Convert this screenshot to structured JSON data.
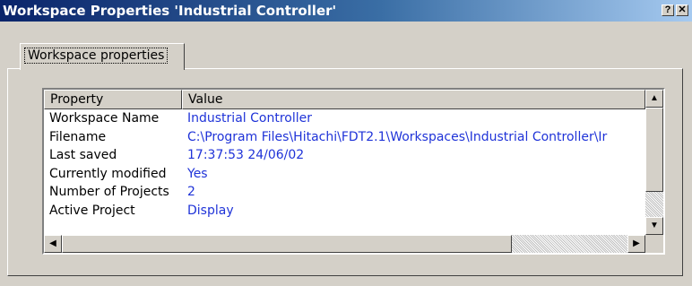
{
  "window": {
    "title": "Workspace Properties 'Industrial Controller'",
    "help_glyph": "?",
    "close_glyph": "✕"
  },
  "tabs": [
    {
      "label": "Workspace properties",
      "active": true
    }
  ],
  "list": {
    "columns": [
      "Property",
      "Value"
    ],
    "rows": [
      {
        "property": "Workspace Name",
        "value": "Industrial Controller"
      },
      {
        "property": "Filename",
        "value": "C:\\Program Files\\Hitachi\\FDT2.1\\Workspaces\\Industrial Controller\\Ir"
      },
      {
        "property": "Last saved",
        "value": "17:37:53  24/06/02"
      },
      {
        "property": "Currently modified",
        "value": "Yes"
      },
      {
        "property": "Number of Projects",
        "value": "2"
      },
      {
        "property": "Active Project",
        "value": "Display"
      }
    ]
  },
  "scrollbars": {
    "up_arrow": "▲",
    "down_arrow": "▼",
    "left_arrow": "◀",
    "right_arrow": "▶"
  },
  "colors": {
    "title_start": "#0a246a",
    "title_end": "#a6caf0",
    "value_text": "#1f33d8",
    "face": "#d4d0c8"
  },
  "icons": {
    "help": "help-icon",
    "close": "close-icon"
  }
}
